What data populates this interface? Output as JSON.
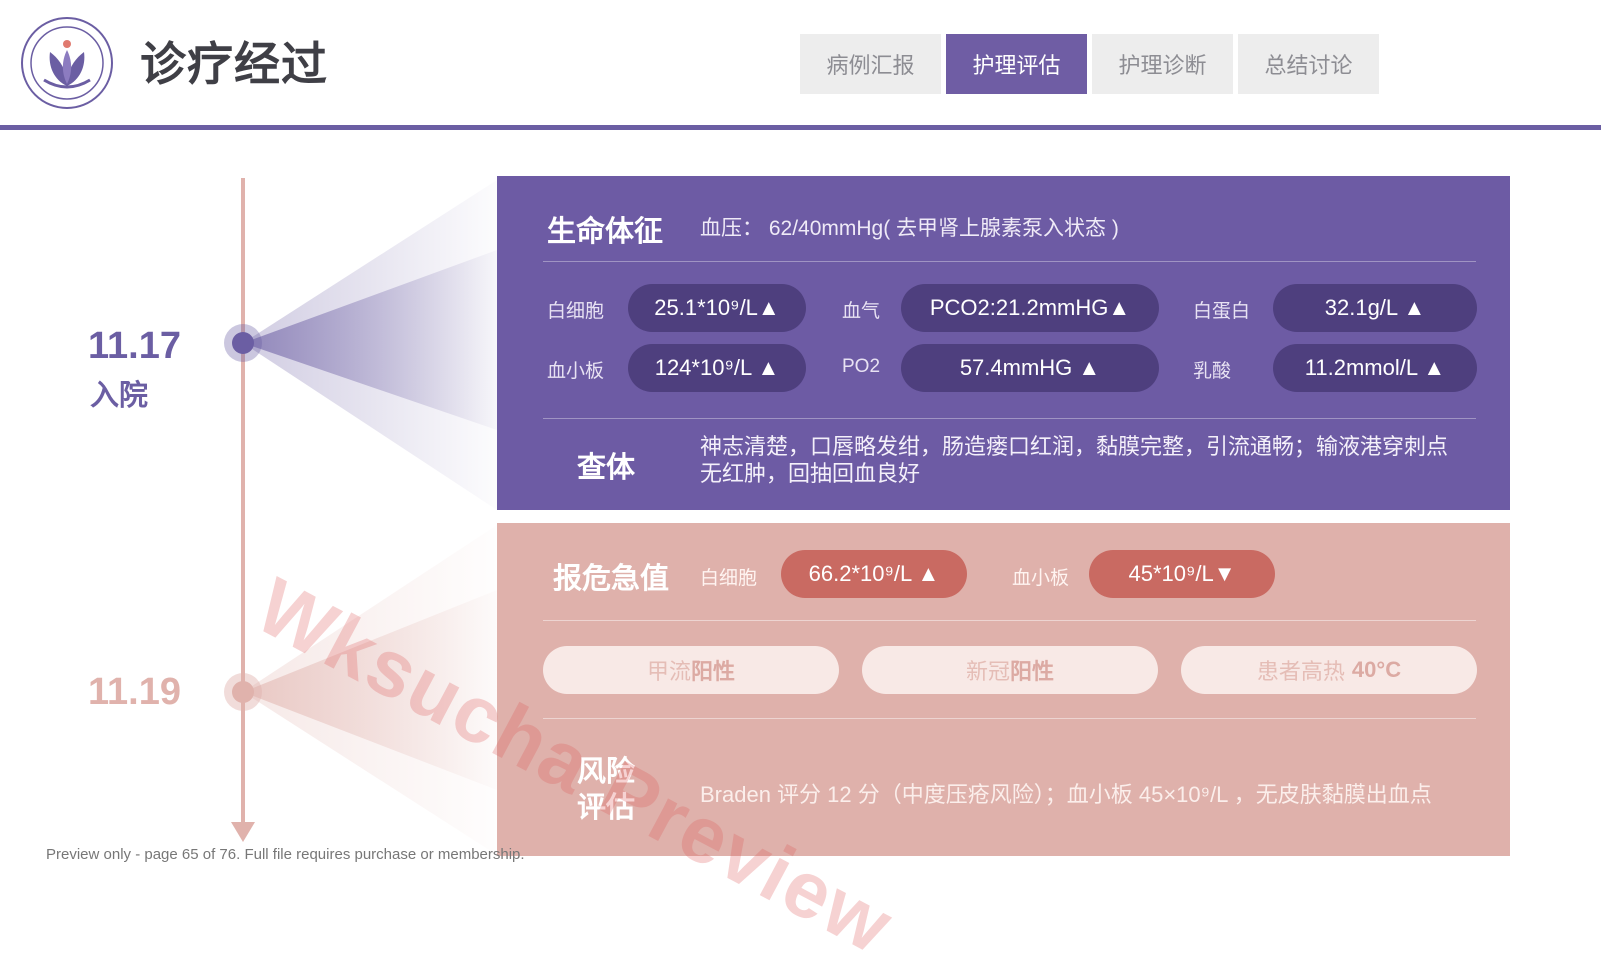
{
  "header": {
    "title": "诊疗经过",
    "tabs": [
      {
        "label": "病例汇报",
        "active": false
      },
      {
        "label": "护理评估",
        "active": true
      },
      {
        "label": "护理诊断",
        "active": false
      },
      {
        "label": "总结讨论",
        "active": false
      }
    ]
  },
  "logo": {
    "icon": "hospital-seal-icon"
  },
  "timeline": {
    "date1": "11.17",
    "date1_label": "入院",
    "date2": "11.19"
  },
  "vitals": {
    "title": "生命体征",
    "blood_pressure": "血压： 62/40mmHg( 去甲肾上腺素泵入状态 )",
    "labs": [
      {
        "label": "白细胞",
        "value": "25.1*10⁹/L▲"
      },
      {
        "label": "血气",
        "value": "PCO2:21.2mmHG▲"
      },
      {
        "label": "白蛋白",
        "value": "32.1g/L ▲"
      },
      {
        "label": "血小板",
        "value": "124*10⁹/L ▲"
      },
      {
        "label": "PO2",
        "value": "57.4mmHG ▲"
      },
      {
        "label": "乳酸",
        "value": "11.2mmol/L ▲"
      }
    ]
  },
  "exam": {
    "title": "查体",
    "text": "神志清楚，口唇略发绀，肠造瘘口红润，黏膜完整，引流通畅；输液港穿刺点无红肿，回抽回血良好"
  },
  "critical": {
    "title": "报危急值",
    "items": [
      {
        "label": "白细胞",
        "value": "66.2*10⁹/L ▲"
      },
      {
        "label": "血小板",
        "value": "45*10⁹/L▼"
      }
    ],
    "tags": [
      {
        "prefix": "甲流",
        "bold": "阳性"
      },
      {
        "prefix": "新冠",
        "bold": "阳性"
      },
      {
        "prefix": "患者高热 ",
        "bold": "40°C"
      }
    ]
  },
  "risk": {
    "title": "风险评估",
    "text": "Braden 评分 12 分（中度压疮风险）；血小板 45×10⁹/L ，无皮肤黏膜出血点"
  },
  "watermark": "Wksucha Preview",
  "footer": "Preview only - page 65 of 76. Full file requires purchase or membership.",
  "colors": {
    "purple": "#6d5ba4",
    "purple_dark": "#4e3f7e",
    "pink": "#dfb1ab",
    "red": "#c96a62"
  }
}
